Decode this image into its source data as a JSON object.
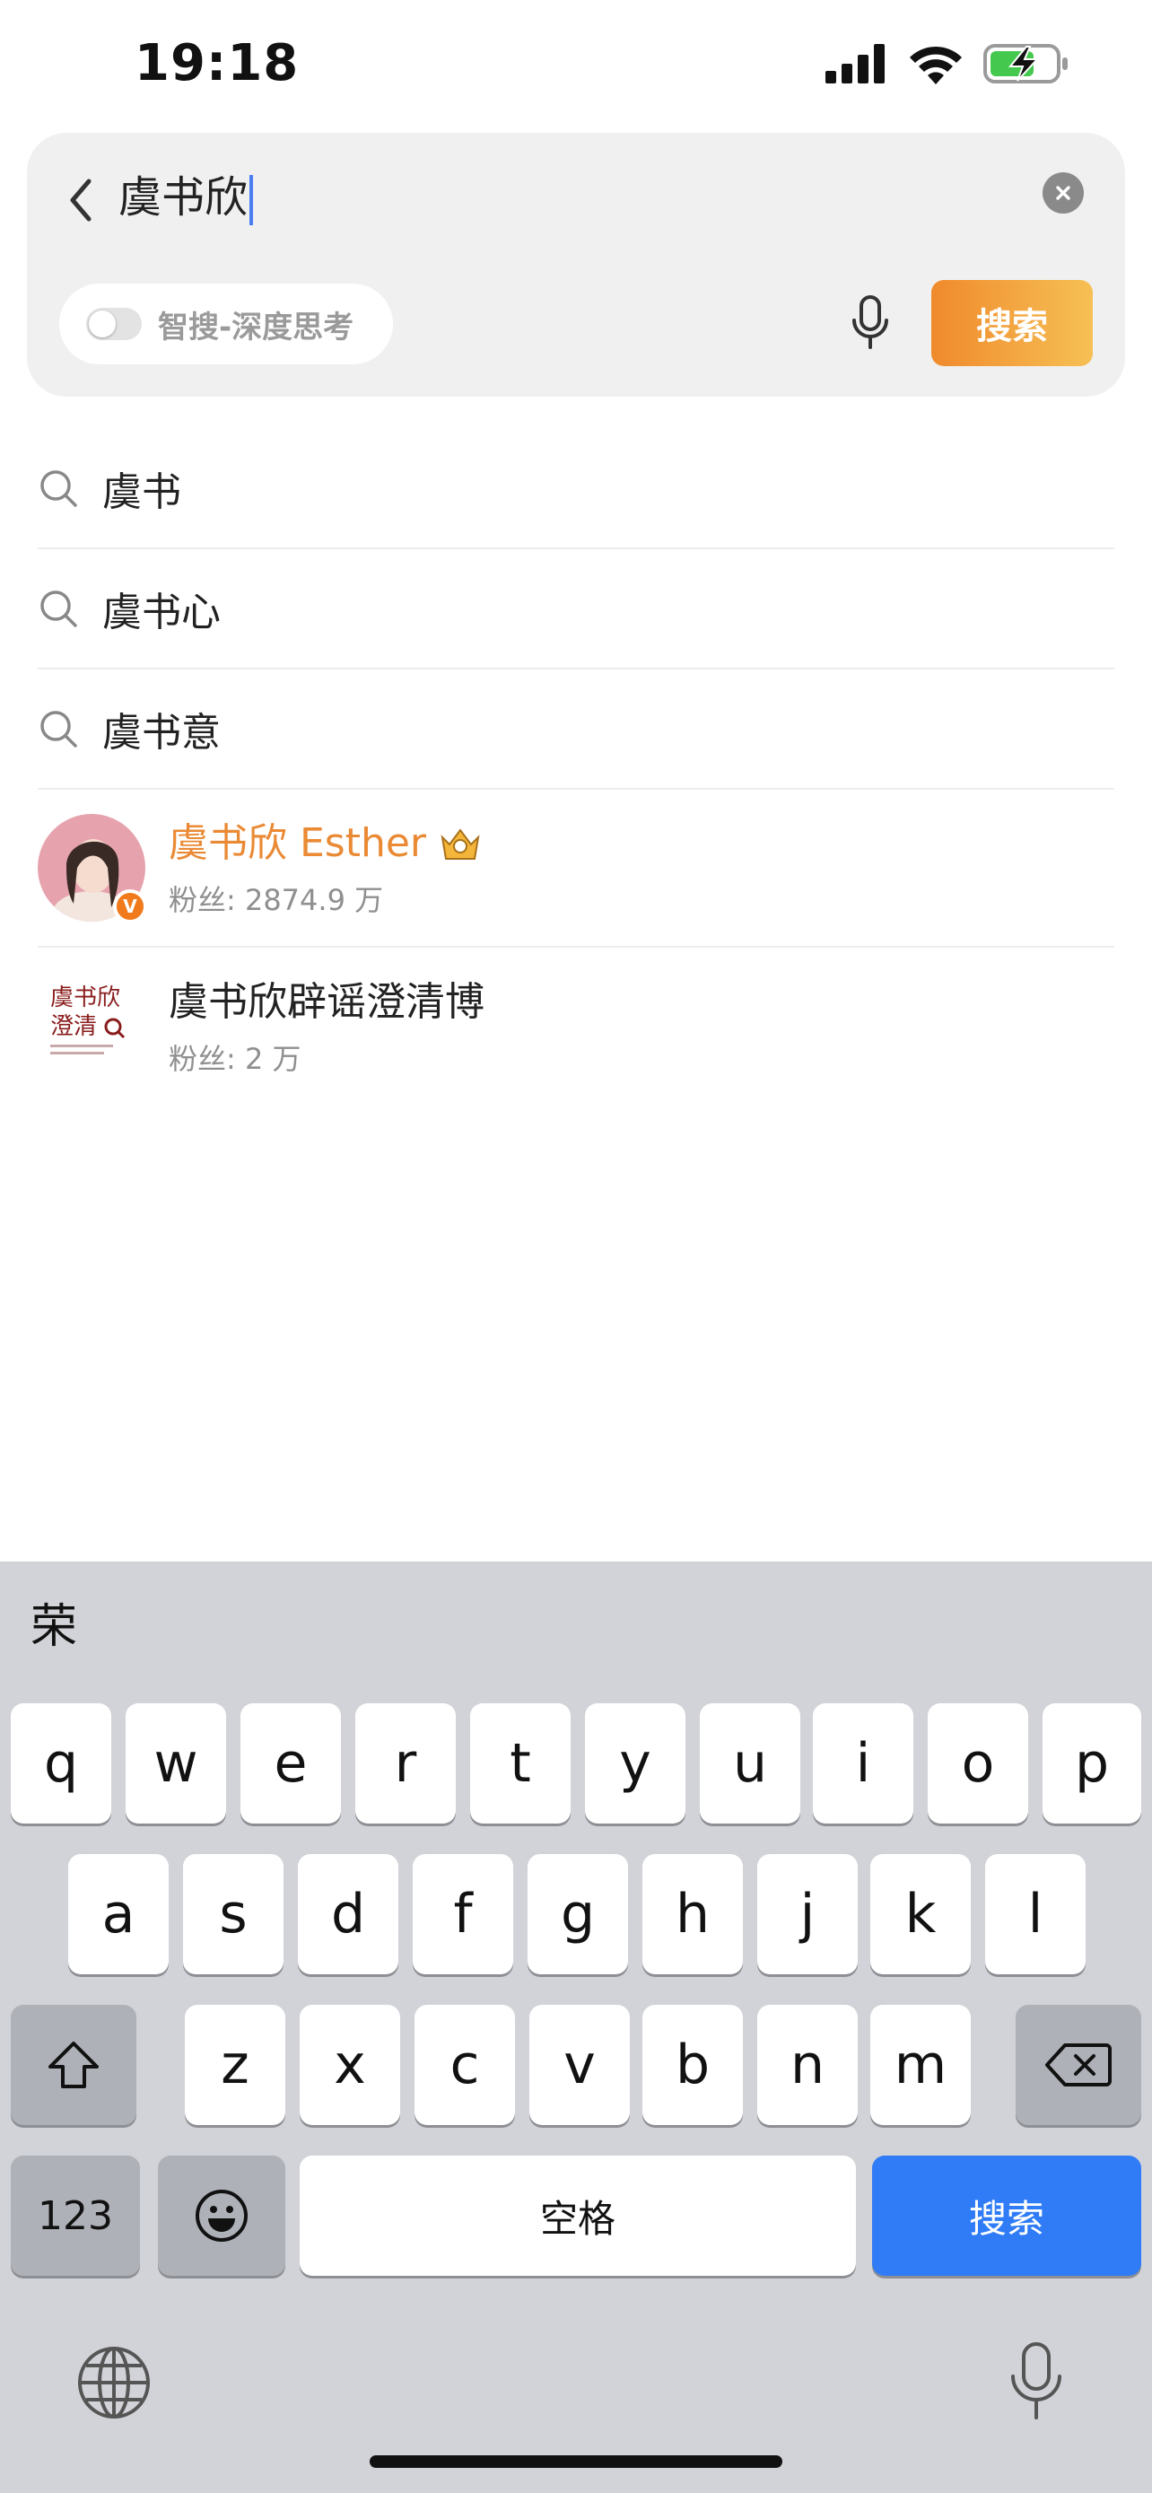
{
  "status": {
    "time": "19:18"
  },
  "search": {
    "query": "虞书欣",
    "deep_label": "智搜-深度思考",
    "button_label": "搜索"
  },
  "suggestions": [
    "虞书",
    "虞书心",
    "虞书意"
  ],
  "users": [
    {
      "name": "虞书欣 Esther",
      "fans": "粉丝: 2874.9 万",
      "verified": true
    },
    {
      "name": "虞书欣辟谣澄清博",
      "fans": "粉丝: 2 万",
      "avatar_text_line1": "虞书欣",
      "avatar_text_line2": "澄清"
    }
  ],
  "keyboard": {
    "candidate": "荣",
    "row1": [
      "q",
      "w",
      "e",
      "r",
      "t",
      "y",
      "u",
      "i",
      "o",
      "p"
    ],
    "row2": [
      "a",
      "s",
      "d",
      "f",
      "g",
      "h",
      "j",
      "k",
      "l"
    ],
    "row3": [
      "z",
      "x",
      "c",
      "v",
      "b",
      "n",
      "m"
    ],
    "num_label": "123",
    "space_label": "空格",
    "go_label": "搜索"
  },
  "colors": {
    "accent_orange": "#ea8a35",
    "go_blue": "#2f7cf6"
  }
}
